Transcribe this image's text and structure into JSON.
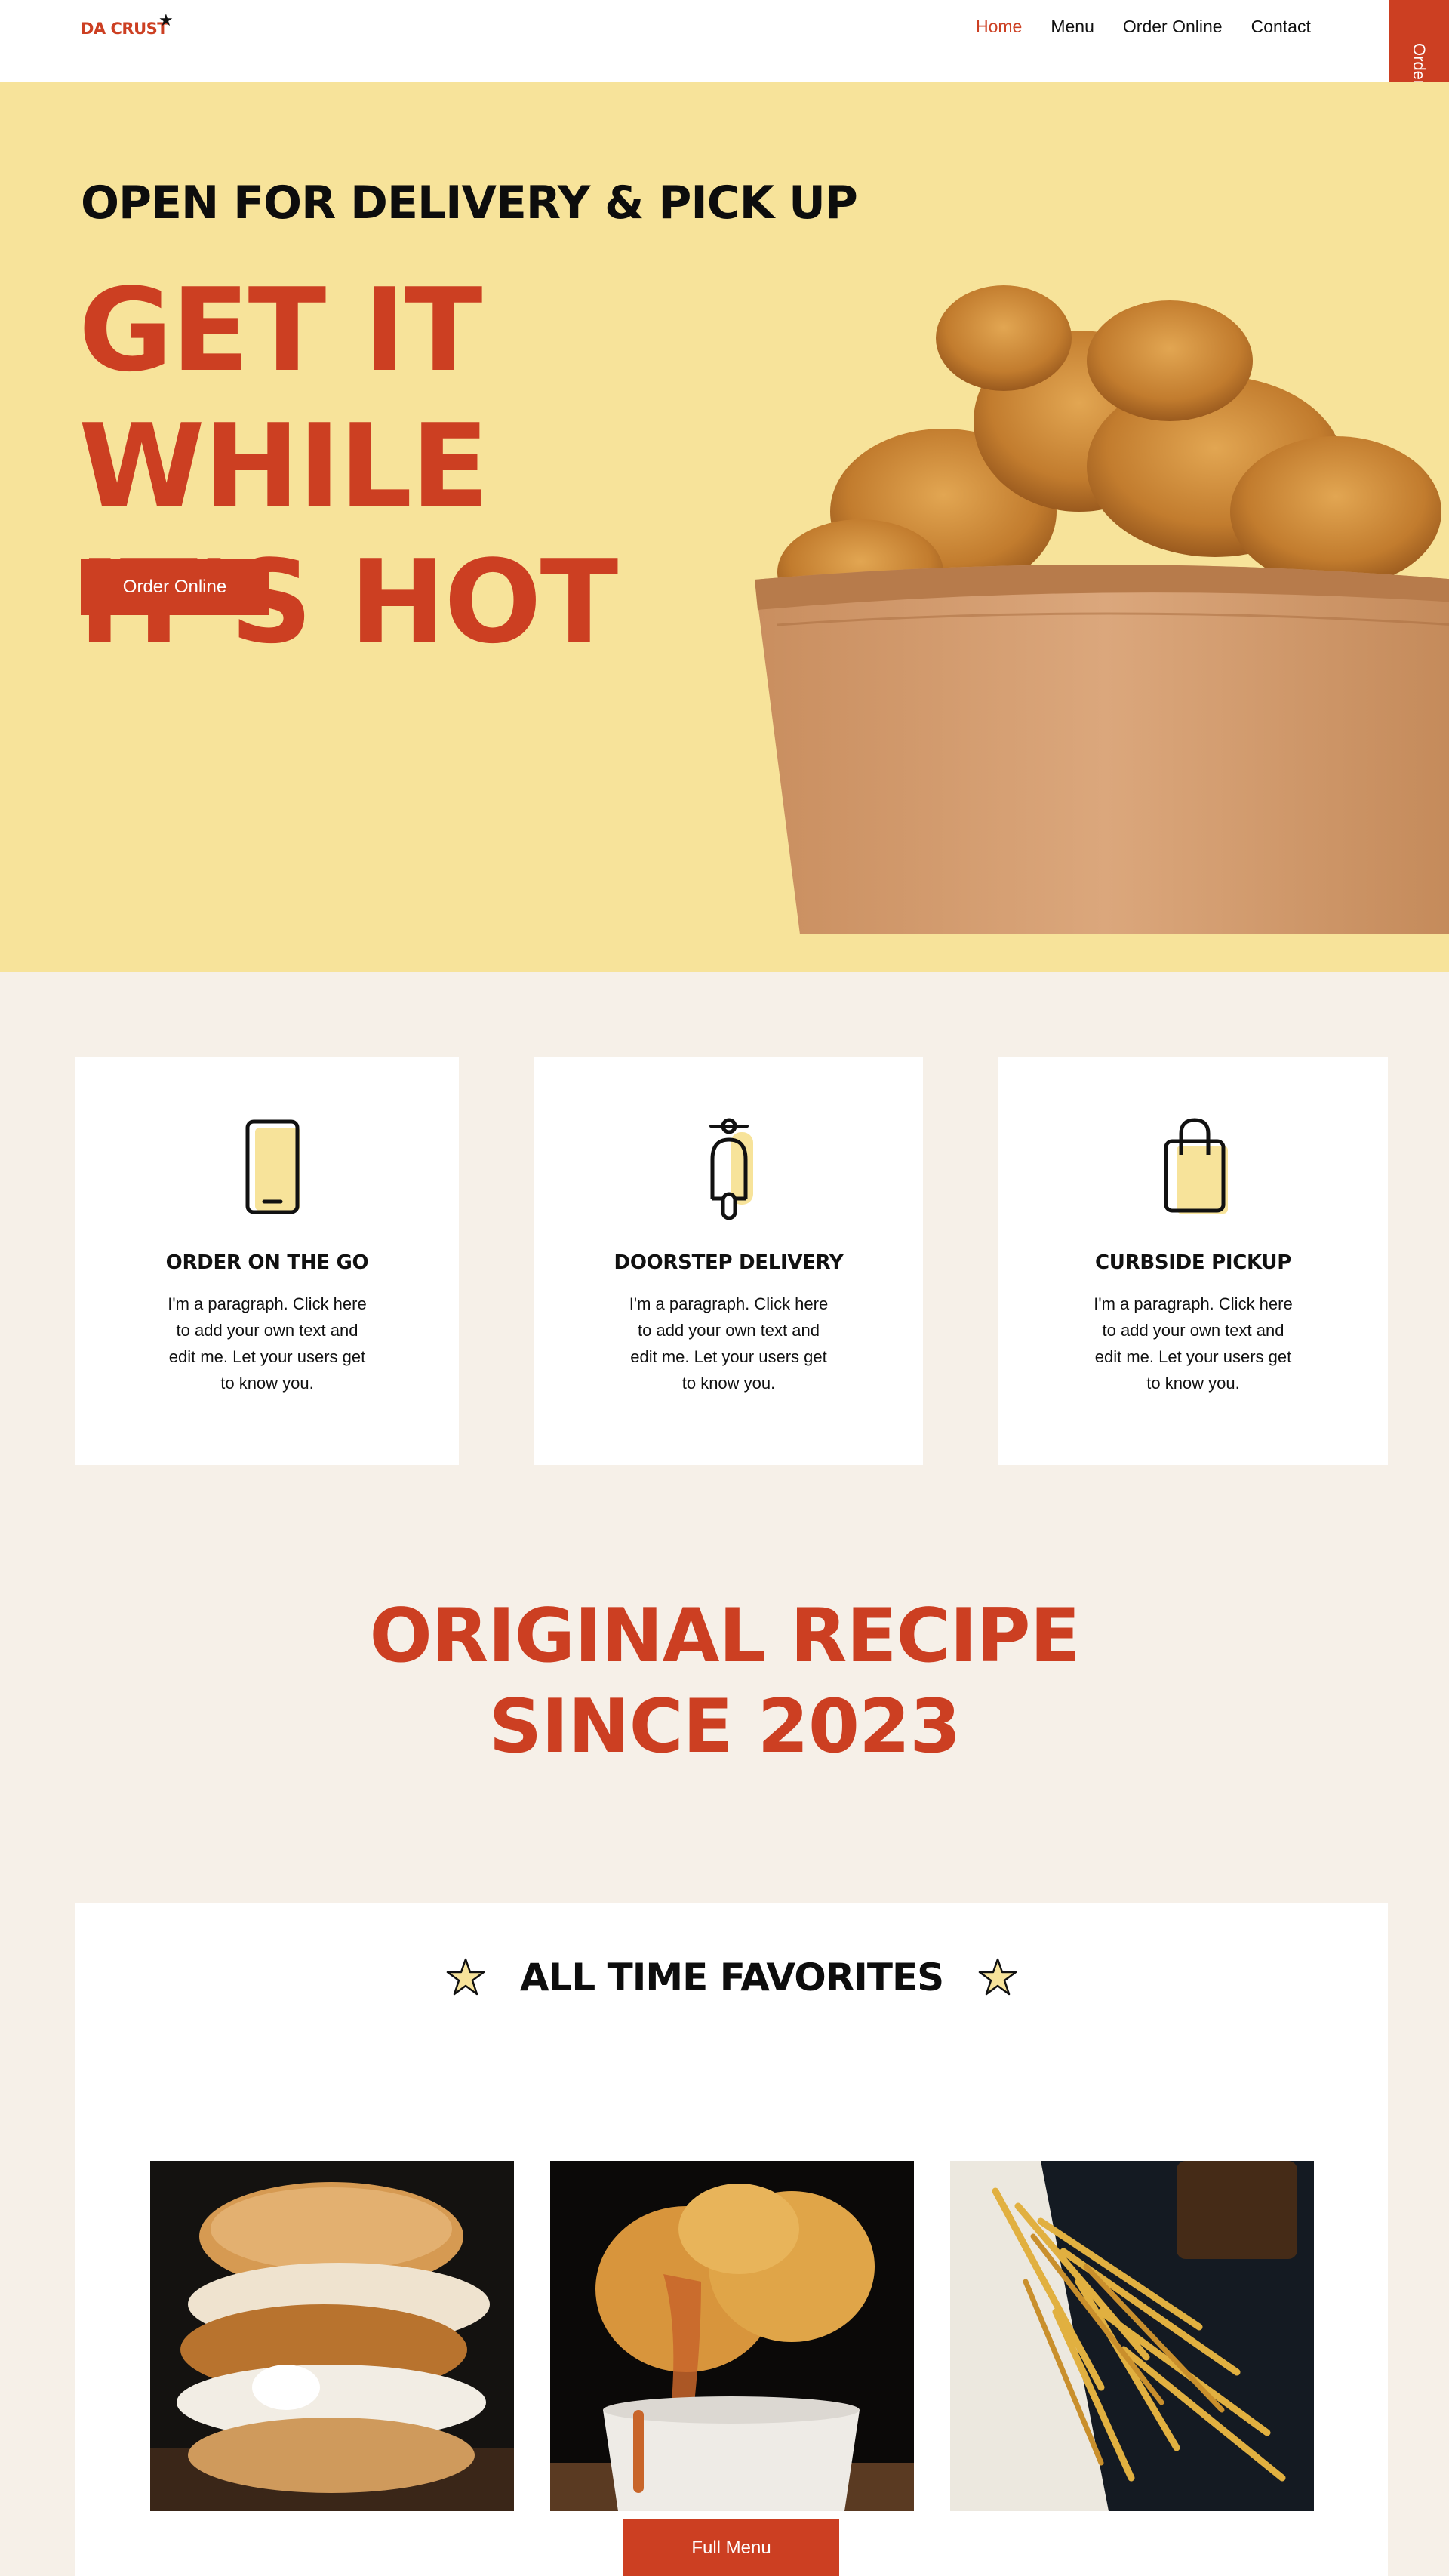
{
  "header": {
    "logo": "DA CRUST",
    "nav": [
      "Home",
      "Menu",
      "Order Online",
      "Contact"
    ],
    "side_tab": "Order Online"
  },
  "hero": {
    "eyebrow": "OPEN FOR DELIVERY & PICK UP",
    "title_line1": "GET IT WHILE",
    "title_line2": "IT'S HOT",
    "button": "Order Online"
  },
  "features": [
    {
      "title": "ORDER ON THE GO",
      "text": "I'm a paragraph. Click here to add your own text and edit me. Let your users get to know you.",
      "icon": "phone-icon"
    },
    {
      "title": "DOORSTEP DELIVERY",
      "text": "I'm a paragraph. Click here to add your own text and edit me. Let your users get to know you.",
      "icon": "scooter-icon"
    },
    {
      "title": "CURBSIDE PICKUP",
      "text": "I'm a paragraph. Click here to add your own text and edit me. Let your users get to know you.",
      "icon": "shopping-bag-icon"
    }
  ],
  "recipe": {
    "line1": "ORIGINAL RECIPE",
    "line2": "SINCE 2023"
  },
  "favorites": {
    "title": "ALL TIME FAVORITES",
    "images": [
      "chicken-biscuit-sandwich",
      "fried-chicken-cup",
      "french-fries"
    ],
    "button": "Full Menu"
  },
  "colors": {
    "accent": "#cc3f22",
    "hero_bg": "#f7e39a",
    "page_bg": "#f6f0e8"
  }
}
